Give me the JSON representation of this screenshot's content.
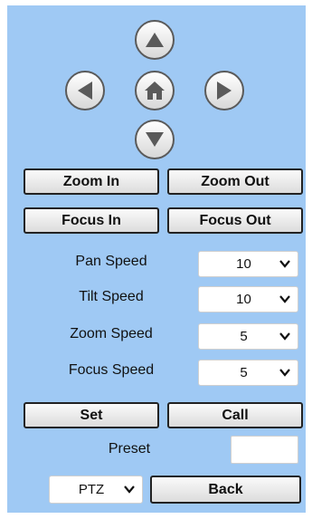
{
  "ptz_pad": {
    "up_icon": "arrow-up-icon",
    "left_icon": "arrow-left-icon",
    "home_icon": "home-icon",
    "right_icon": "arrow-right-icon",
    "down_icon": "arrow-down-icon"
  },
  "zoom": {
    "in_label": "Zoom In",
    "out_label": "Zoom Out"
  },
  "focus": {
    "in_label": "Focus In",
    "out_label": "Focus Out"
  },
  "speeds": {
    "pan": {
      "label": "Pan Speed",
      "value": "10"
    },
    "tilt": {
      "label": "Tilt Speed",
      "value": "10"
    },
    "zoom": {
      "label": "Zoom Speed",
      "value": "5"
    },
    "focus": {
      "label": "Focus Speed",
      "value": "5"
    }
  },
  "preset": {
    "set_label": "Set",
    "call_label": "Call",
    "label": "Preset",
    "value": ""
  },
  "footer": {
    "mode_value": "PTZ",
    "back_label": "Back"
  },
  "colors": {
    "panel_bg": "#9fc9f4",
    "icon_dark": "#5a5a5a"
  }
}
